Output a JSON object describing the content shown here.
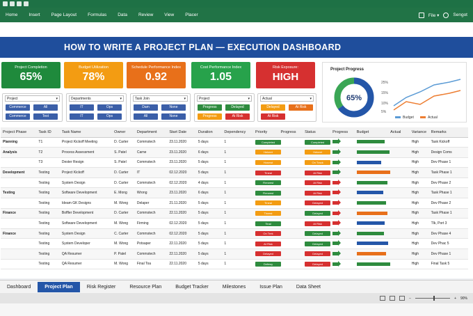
{
  "ribbon": {
    "tabs": [
      "Home",
      "Insert",
      "Page Layout",
      "Formulas",
      "Data",
      "Review",
      "View",
      "Placer"
    ],
    "file_label": "File ▾",
    "user_label": "Sengot"
  },
  "banner_title": "HOW TO WRITE A PROJECT PLAN — EXECUTION DASHBOARD",
  "kpis": [
    {
      "label": "Project Completion",
      "value": "65%",
      "color": "#1f8a3c"
    },
    {
      "label": "Budget Utilization",
      "value": "78%",
      "color": "#f39c12"
    },
    {
      "label": "Schedule Performance Index",
      "value": "0.92",
      "color": "#e8701a"
    },
    {
      "label": "Cost Performance Index",
      "value": "1.05",
      "color": "#27a24b"
    },
    {
      "label": "Risk Exposure:",
      "value": "HIGH",
      "color": "#d63030"
    }
  ],
  "progress_chart": {
    "title": "Project Progress",
    "donut_value": "65%",
    "donut_fraction": 0.65,
    "y_ticks": [
      "25%",
      "15%",
      "10%",
      "5%"
    ],
    "legend": [
      "Budget",
      "Actual"
    ],
    "budget_color": "#5b9bd5",
    "actual_color": "#ed7d31"
  },
  "filters": [
    {
      "label": "Project",
      "buttons": [
        [
          "Commerce",
          "#3b5fa8"
        ],
        [
          "All",
          "#3b5fa8"
        ],
        [
          "Commerce",
          "#3b5fa8"
        ],
        [
          "Test",
          "#3b5fa8"
        ]
      ]
    },
    {
      "label": "Departments",
      "buttons": [
        [
          "IT",
          "#3b5fa8"
        ],
        [
          "Ops",
          "#3b5fa8"
        ],
        [
          "IT",
          "#3b5fa8"
        ],
        [
          "Ops",
          "#3b5fa8"
        ]
      ]
    },
    {
      "label": "Task Join",
      "buttons": [
        [
          "Dam",
          "#3b5fa8"
        ],
        [
          "None",
          "#3b5fa8"
        ],
        [
          "All",
          "#3b5fa8"
        ],
        [
          "None",
          "#3b5fa8"
        ]
      ]
    },
    {
      "label": "Project",
      "buttons": [
        [
          "Progress",
          "#2e8b3e"
        ],
        [
          "Delayed",
          "#2e8b3e"
        ],
        [
          "Progress",
          "#f39c12"
        ],
        [
          "At Risk",
          "#d63030"
        ]
      ]
    },
    {
      "label": "Actual",
      "buttons": [
        [
          "Delayed",
          "#f39c12"
        ],
        [
          "At Risk",
          "#e8701a"
        ],
        [
          "At Risk",
          "#d63030"
        ],
        [
          "",
          "#ffffff"
        ]
      ]
    }
  ],
  "table": {
    "headers": [
      "Project Phase",
      "Task ID",
      "Task Name",
      "Owner",
      "Department",
      "Start Date",
      "Duration",
      "Dependency",
      "Priority",
      "Progress",
      "Status",
      "Progress",
      "Budget",
      "Actual",
      "Variance",
      "Remarks"
    ],
    "rows": [
      {
        "phase": "Planning",
        "id": "T1",
        "name": "Project Kickoff Meeting",
        "owner": "D. Carter",
        "dept": "Commstech",
        "start": "23.11.2020",
        "dur": "5 days",
        "dep": "1",
        "p1": [
          "Completed",
          "#2e8b3e"
        ],
        "st": [
          "Completed",
          "#2e8b3e"
        ],
        "trend": [
          "#2e8b3e"
        ],
        "budget": 40,
        "bcolor": "#2e8b3e",
        "var": "High",
        "rem": "Task Kickoff"
      },
      {
        "phase": "Analysis",
        "id": "T2",
        "name": "Process Assessment",
        "owner": "S. Patel",
        "dept": "Carne",
        "start": "23.11.2020",
        "dur": "6 days",
        "dep": "1",
        "p1": [
          "Hekeet",
          "#f39c12"
        ],
        "st": [
          "Hekeet",
          "#f39c12"
        ],
        "trend": [
          "#2e8b3e"
        ],
        "budget": 47,
        "bcolor": "#2e8b3e",
        "var": "High",
        "rem": "Design Coms"
      },
      {
        "phase": "",
        "id": "T3",
        "name": "Dester Resign",
        "owner": "S. Patel",
        "dept": "Commstech",
        "start": "23.11.2020",
        "dur": "5 days",
        "dep": "1",
        "p1": [
          "Hosrvst",
          "#f39c12"
        ],
        "st": [
          "On Track",
          "#f39c12"
        ],
        "trend": [
          "#2e8b3e"
        ],
        "budget": 35,
        "bcolor": "#2456a8",
        "var": "High",
        "rem": "Dev Phase 1"
      },
      {
        "phase": "Development",
        "id": "Testing",
        "name": "Project Kickoff",
        "owner": "D. Carter",
        "dept": "IT",
        "start": "02.12.2020",
        "dur": "5 days",
        "dep": "1",
        "p1": [
          "Tineal",
          "#d63030"
        ],
        "st": [
          "At Risk",
          "#d63030"
        ],
        "trend": [
          "#2e8b3e"
        ],
        "budget": 48,
        "bcolor": "#e8701a",
        "var": "High",
        "rem": "Task Phase 1"
      },
      {
        "phase": "",
        "id": "Testing",
        "name": "System Design",
        "owner": "D. Carter",
        "dept": "Commstech",
        "start": "02.12.2020",
        "dur": "4 days",
        "dep": "1",
        "p1": [
          "Fierwest",
          "#2e8b3e"
        ],
        "st": [
          "At Risk",
          "#d63030"
        ],
        "trend": [
          "#d63030"
        ],
        "budget": 44,
        "bcolor": "#2e8b3e",
        "var": "High",
        "rem": "Dev Phase 2"
      },
      {
        "phase": "Testing",
        "id": "Testing",
        "name": "Software Development",
        "owner": "E. Mong",
        "dept": "Wrong",
        "start": "23.11.2020",
        "dur": "6 days",
        "dep": "1",
        "p1": [
          "Fierwest",
          "#2e8b3e"
        ],
        "st": [
          "At Risk",
          "#d63030"
        ],
        "trend": [
          "#d63030"
        ],
        "budget": 38,
        "bcolor": "#2456a8",
        "var": "High",
        "rem": "Task Phase 1"
      },
      {
        "phase": "",
        "id": "Testing",
        "name": "Ideam GK Designs",
        "owner": "M. Wong",
        "dept": "Delaper",
        "start": "21.11.2020",
        "dur": "5 days",
        "dep": "1",
        "p1": [
          "Tineal",
          "#f39c12"
        ],
        "st": [
          "Delayed",
          "#d63030"
        ],
        "trend": [
          "#d63030"
        ],
        "budget": 42,
        "bcolor": "#2e8b3e",
        "var": "High",
        "rem": "Dev Phase 2"
      },
      {
        "phase": "Finance",
        "id": "Testing",
        "name": "Boffler Development",
        "owner": "D. Carter",
        "dept": "Commstech",
        "start": "22.11.2020",
        "dur": "5 days",
        "dep": "1",
        "p1": [
          "Tinrest",
          "#f39c12"
        ],
        "st": [
          "Delayed",
          "#2e8b3e"
        ],
        "trend": [
          "#d63030"
        ],
        "budget": 44,
        "bcolor": "#e8701a",
        "var": "High",
        "rem": "Task Phase 1"
      },
      {
        "phase": "",
        "id": "Testing",
        "name": "Software Development",
        "owner": "M. Wong",
        "dept": "Firming",
        "start": "02.12.2020",
        "dur": "5 days",
        "dep": "1",
        "p1": [
          "Tinal",
          "#2e8b3e"
        ],
        "st": [
          "At Risk",
          "#d63030"
        ],
        "trend": [
          "#d63030"
        ],
        "budget": 40,
        "bcolor": "#2456a8",
        "var": "High",
        "rem": "Tlk, Port 3"
      },
      {
        "phase": "Finance",
        "id": "Testing",
        "name": "System Design",
        "owner": "C. Carter",
        "dept": "Commstech",
        "start": "02.12.2020",
        "dur": "5 days",
        "dep": "1",
        "p1": [
          "On Trek",
          "#d63030"
        ],
        "st": [
          "Delayed",
          "#2e8b3e"
        ],
        "trend": [
          "#2e8b3e"
        ],
        "budget": 39,
        "bcolor": "#2e8b3e",
        "var": "High",
        "rem": "Dev Phase 4"
      },
      {
        "phase": "",
        "id": "Testing",
        "name": "System Developer",
        "owner": "M. Wong",
        "dept": "Potsaper",
        "start": "22.11.2020",
        "dur": "5 days",
        "dep": "1",
        "p1": [
          "At Risk",
          "#d63030"
        ],
        "st": [
          "Delayed",
          "#2e8b3e"
        ],
        "trend": [
          "#2e8b3e"
        ],
        "budget": 45,
        "bcolor": "#2456a8",
        "var": "High",
        "rem": "Dev Phac 5"
      },
      {
        "phase": "",
        "id": "Testing",
        "name": "QA Resumer",
        "owner": "P. Patel",
        "dept": "Commstech",
        "start": "22.11.2020",
        "dur": "5 days",
        "dep": "1",
        "p1": [
          "Delayed",
          "#d63030"
        ],
        "st": [
          "Delayed",
          "#d63030"
        ],
        "trend": [
          "#2e8b3e"
        ],
        "budget": 42,
        "bcolor": "#e8701a",
        "var": "High",
        "rem": "Dev Phase 1"
      },
      {
        "phase": "",
        "id": "Testing",
        "name": "QA Resumer",
        "owner": "M. Wong",
        "dept": "Final Toa",
        "start": "22.11.2020",
        "dur": "5 days",
        "dep": "1",
        "p1": [
          "Defewy",
          "#2e8b3e"
        ],
        "st": [
          "Delayed",
          "#d63030"
        ],
        "trend": [
          "#2e8b3e"
        ],
        "budget": 48,
        "bcolor": "#2e8b3e",
        "var": "High",
        "rem": "Final Task 5"
      }
    ]
  },
  "sheet_tabs": [
    "Dashboard",
    "Project Plan",
    "Risk Register",
    "Resource Plan",
    "Budget Tracker",
    "Milestones",
    "Issue Plan",
    "Data Sheet"
  ],
  "active_sheet_tab": 1,
  "zoom_label": "90%"
}
